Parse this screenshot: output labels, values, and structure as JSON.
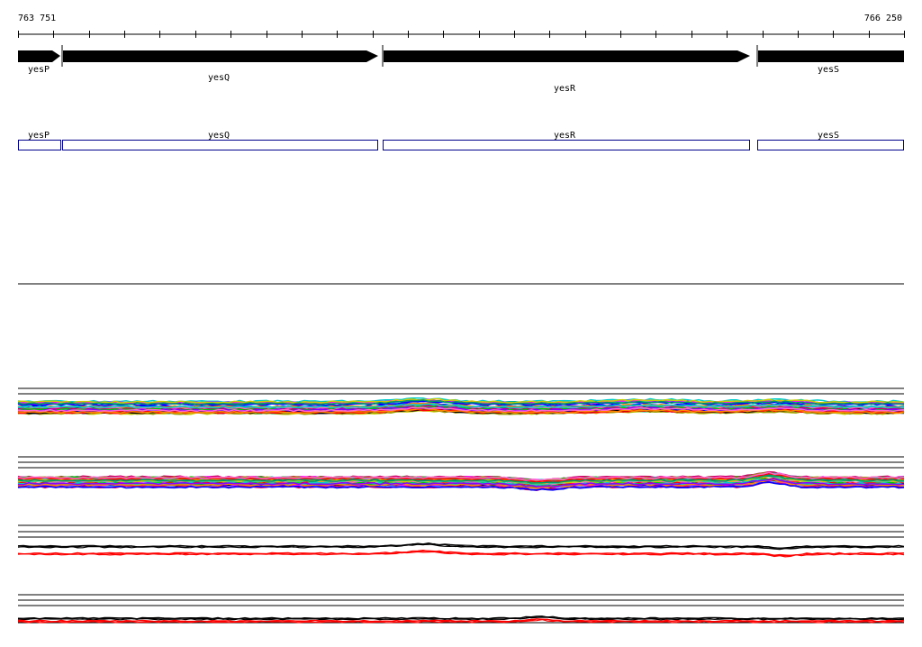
{
  "ruler": {
    "start_label": "763 751",
    "end_label": "766 250"
  },
  "genes": [
    {
      "name": "yesP",
      "strand": "+"
    },
    {
      "name": "yesQ",
      "strand": "+"
    },
    {
      "name": "yesR",
      "strand": "+"
    },
    {
      "name": "yesS",
      "strand": "+"
    }
  ],
  "colors": {
    "gene_arrow": "#000000",
    "gene_box_outline": "#00008b",
    "track_line": "#000000",
    "signal_red": "#ff0000"
  },
  "tracks": [
    {
      "id": "expression-track-1",
      "style": "multicolor"
    },
    {
      "id": "expression-track-2",
      "style": "multicolor"
    },
    {
      "id": "expression-track-3",
      "style": "black-red"
    },
    {
      "id": "expression-track-4",
      "style": "black-red"
    }
  ]
}
